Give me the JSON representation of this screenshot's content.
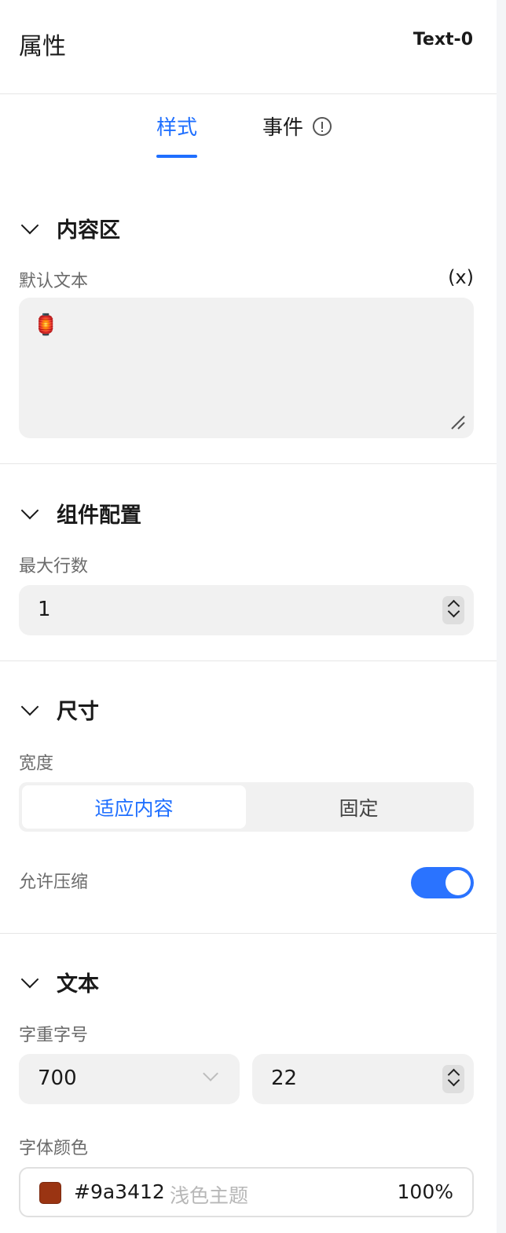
{
  "header": {
    "title": "属性",
    "component_id": "Text-0"
  },
  "tabs": [
    {
      "label": "样式",
      "active": true
    },
    {
      "label": "事件",
      "active": false,
      "icon": "info-icon"
    }
  ],
  "sections": {
    "content": {
      "title": "内容区",
      "default_text_label": "默认文本",
      "variable_toggle": "(x)",
      "default_text_value": "🏮"
    },
    "component_config": {
      "title": "组件配置",
      "max_lines_label": "最大行数",
      "max_lines_value": "1"
    },
    "size": {
      "title": "尺寸",
      "width_label": "宽度",
      "width_options": [
        "适应内容",
        "固定"
      ],
      "width_selected": "适应内容",
      "shrink_label": "允许压缩",
      "shrink_enabled": true
    },
    "text": {
      "title": "文本",
      "weight_size_label": "字重字号",
      "font_weight": "700",
      "font_size": "22",
      "color_label": "字体颜色",
      "color_hex": "#9a3412",
      "color_theme_placeholder": "浅色主题",
      "color_opacity": "100%"
    }
  },
  "colors": {
    "accent": "#1f6fff",
    "toggle_on": "#2a73ff",
    "font_color_swatch": "#9a3412"
  }
}
